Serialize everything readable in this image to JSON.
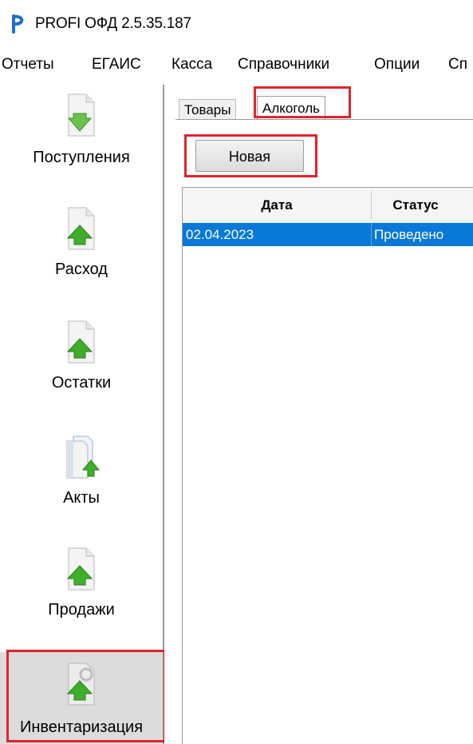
{
  "app": {
    "title": "PROFI ОФД 2.5.35.187",
    "logo_color": "#1a6fd1"
  },
  "menu": {
    "items": [
      "Отчеты",
      "ЕГАИС",
      "Касса",
      "Справочники",
      "Опции",
      "Сп"
    ]
  },
  "nav": {
    "items": [
      {
        "label": "Поступления",
        "icon": "arrow-down-document-icon"
      },
      {
        "label": "Расход",
        "icon": "arrow-up-document-icon"
      },
      {
        "label": "Остатки",
        "icon": "arrow-up-document-icon"
      },
      {
        "label": "Акты",
        "icon": "documents-arrow-icon"
      },
      {
        "label": "Продажи",
        "icon": "arrow-up-document-icon"
      },
      {
        "label": "Инвентаризация",
        "icon": "arrow-up-tools-icon"
      }
    ],
    "active_index": 5
  },
  "tabs": {
    "items": [
      "Товары",
      "Алкоголь"
    ],
    "active_index": 1
  },
  "toolbar": {
    "new_label": "Новая"
  },
  "grid": {
    "columns": [
      "Дата",
      "Статус"
    ],
    "rows": [
      {
        "date": "02.04.2023",
        "status": "Проведено",
        "selected": true
      }
    ]
  },
  "colors": {
    "highlight": "#e1232b",
    "selection": "#0a78d7",
    "arrow_green": "#3fae2a",
    "arrow_green_down": "#6cc24a"
  }
}
